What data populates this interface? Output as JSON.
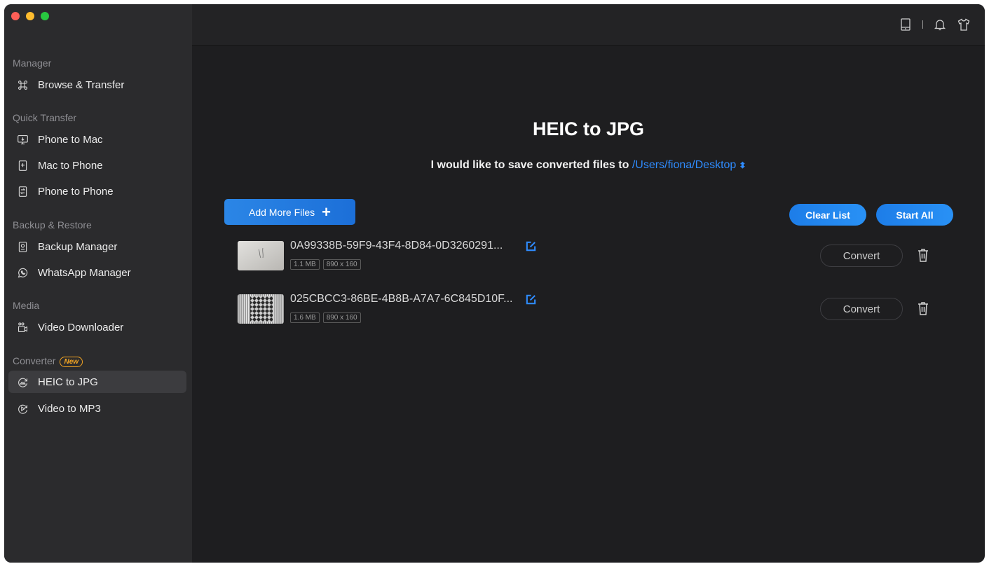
{
  "sidebar": {
    "sections": {
      "manager": "Manager",
      "quick_transfer": "Quick Transfer",
      "backup_restore": "Backup & Restore",
      "media": "Media",
      "converter": "Converter",
      "converter_badge": "New"
    },
    "items": {
      "browse_transfer": "Browse & Transfer",
      "phone_to_mac": "Phone to Mac",
      "mac_to_phone": "Mac to Phone",
      "phone_to_phone": "Phone to Phone",
      "backup_manager": "Backup Manager",
      "whatsapp_manager": "WhatsApp Manager",
      "video_downloader": "Video Downloader",
      "heic_to_jpg": "HEIC to JPG",
      "video_to_mp3": "Video to MP3"
    },
    "active_item": "HEIC to JPG"
  },
  "topbar": {
    "icons": [
      "device-icon",
      "bell-icon",
      "tshirt-icon"
    ]
  },
  "main": {
    "title": "HEIC to JPG",
    "save_prefix": "I would like to save converted files to",
    "save_path": "/Users/fiona/Desktop",
    "add_button": "Add More Files",
    "clear_button": "Clear List",
    "start_button": "Start All",
    "files": [
      {
        "name": "0A99338B-59F9-43F4-8D84-0D3260291...",
        "size": "1.1 MB",
        "dims": "890 x 160",
        "action": "Convert"
      },
      {
        "name": "025CBCC3-86BE-4B8B-A7A7-6C845D10F...",
        "size": "1.6 MB",
        "dims": "890 x 160",
        "action": "Convert"
      }
    ]
  },
  "colors": {
    "accent": "#2f8cff",
    "badge": "#f5a623",
    "sidebar_bg": "#2b2b2d",
    "main_bg": "#1e1e20"
  }
}
